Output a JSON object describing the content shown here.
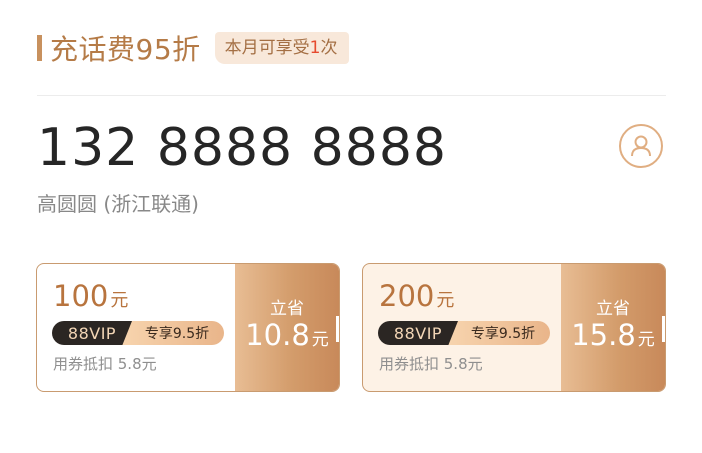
{
  "header": {
    "title": "充话费95折",
    "badge_prefix": "本月可享受",
    "badge_count": "1",
    "badge_suffix": "次"
  },
  "account": {
    "phone": "132 8888 8888",
    "owner": "高圆圆 (浙江联通)"
  },
  "cards": [
    {
      "amount": "100",
      "amount_unit": "元",
      "vip_label": "88VIP",
      "vip_offer": "专享9.5折",
      "coupon": "用券抵扣 5.8元",
      "save_label": "立省",
      "save_value": "10.8",
      "save_unit": "元"
    },
    {
      "amount": "200",
      "amount_unit": "元",
      "vip_label": "88VIP",
      "vip_offer": "专享9.5折",
      "coupon": "用券抵扣 5.8元",
      "save_label": "立省",
      "save_value": "15.8",
      "save_unit": "元"
    }
  ],
  "icons": {
    "contact": "contact-person-icon"
  },
  "colors": {
    "accent": "#b57b47",
    "highlight": "#e64a2e",
    "card_border": "#c99b70"
  }
}
